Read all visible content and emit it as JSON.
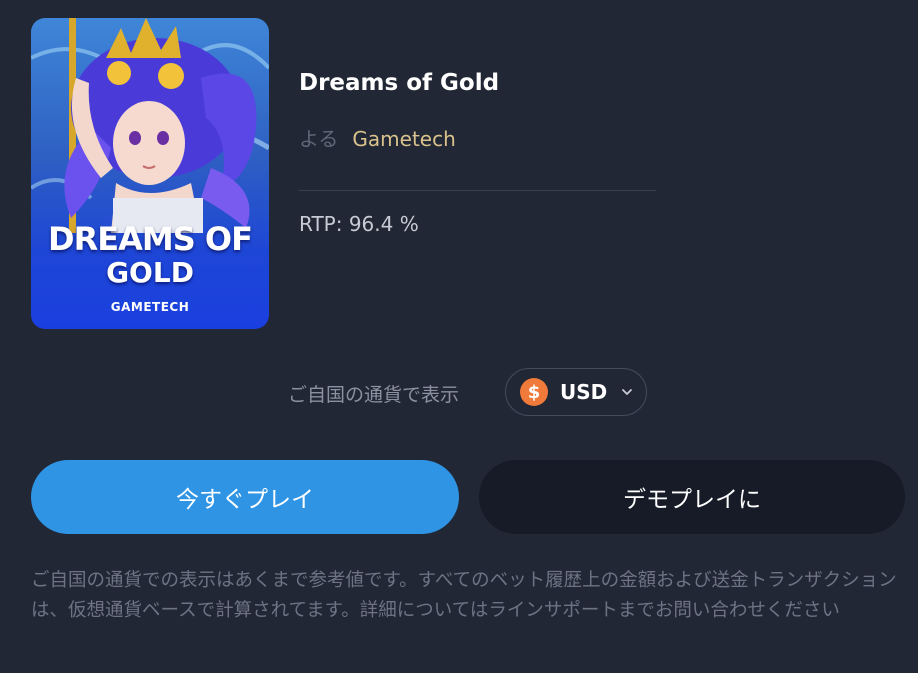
{
  "game": {
    "title": "Dreams of Gold",
    "by_label": "よる",
    "provider": "Gametech",
    "rtp": "RTP: 96.4 %",
    "thumbnail": {
      "title_line1": "DREAMS OF",
      "title_line2": "GOLD",
      "brand": "GAMETECH"
    }
  },
  "currency": {
    "label": "ご自国の通貨で表示",
    "selected": "USD",
    "coin_symbol": "$",
    "icon": "dollar-coin-icon",
    "coin_color": "#f07a3a"
  },
  "buttons": {
    "play_now": "今すぐプレイ",
    "demo": "デモプレイに",
    "play_color": "#2f94e4"
  },
  "note": "ご自国の通貨での表示はあくまで参考値です。すべてのベット履歴上の金額および送金トランザクションは、仮想通貨ベースで計算されてます。詳細についてはラインサポートまでお問い合わせください"
}
